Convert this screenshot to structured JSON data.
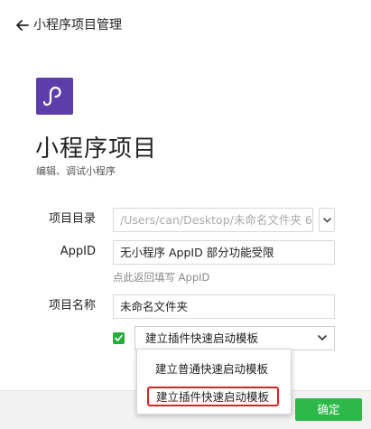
{
  "topbar": {
    "title": "小程序项目管理"
  },
  "app": {
    "title": "小程序项目",
    "subtitle": "编辑、调试小程序"
  },
  "form": {
    "directory": {
      "label": "项目目录",
      "placeholder": "/Users/can/Desktop/未命名文件夹 6"
    },
    "appid": {
      "label": "AppID",
      "value": "无小程序 AppID 部分功能受限",
      "hint": "点此返回填写 AppID"
    },
    "name": {
      "label": "项目名称",
      "value": "未命名文件夹"
    },
    "template": {
      "checked": true,
      "selected": "建立插件快速启动模板",
      "options": [
        "建立普通快速启动模板",
        "建立插件快速启动模板"
      ]
    }
  },
  "footer": {
    "confirm_label": "确定"
  },
  "colors": {
    "brand_logo": "#5d3ea8",
    "accent_green": "#2eb84a",
    "checkbox_green": "#26ad3b",
    "highlight_red": "#e02020"
  },
  "icons": {
    "back": "arrow-left-icon",
    "logo": "miniprogram-logo-icon",
    "dropdown": "chevron-down-icon",
    "check": "check-icon"
  }
}
